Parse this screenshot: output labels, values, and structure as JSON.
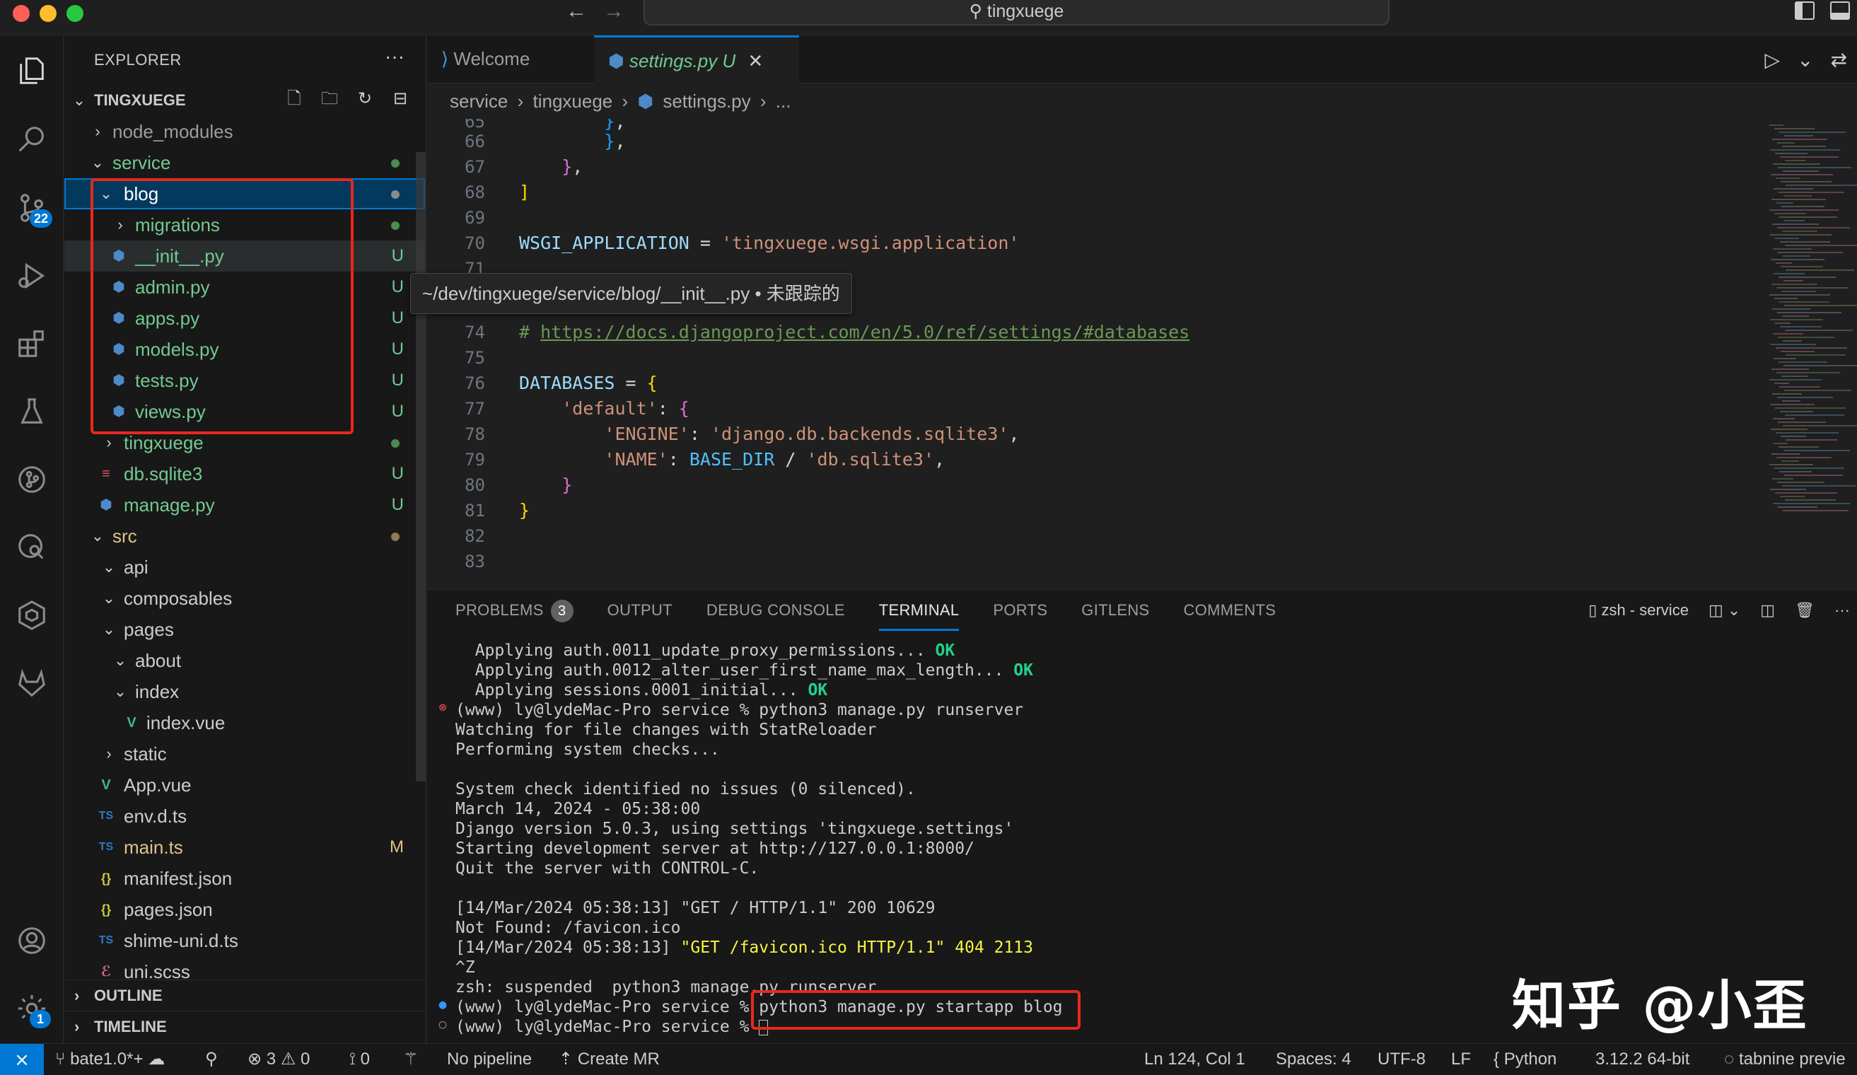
{
  "window": {
    "title": "tingxuege"
  },
  "activity": {
    "scm_badge": "22",
    "settings_badge": "1"
  },
  "sidebar": {
    "title": "EXPLORER",
    "more": "···",
    "root": "TINGXUEGE",
    "tree": [
      {
        "label": "node_modules",
        "status": ""
      },
      {
        "label": "service",
        "status": ""
      },
      {
        "label": "blog",
        "status": ""
      },
      {
        "label": "migrations",
        "status": ""
      },
      {
        "label": "__init__.py",
        "status": "U"
      },
      {
        "label": "admin.py",
        "status": "U"
      },
      {
        "label": "apps.py",
        "status": "U"
      },
      {
        "label": "models.py",
        "status": "U"
      },
      {
        "label": "tests.py",
        "status": "U"
      },
      {
        "label": "views.py",
        "status": "U"
      },
      {
        "label": "tingxuege",
        "status": ""
      },
      {
        "label": "db.sqlite3",
        "status": "U"
      },
      {
        "label": "manage.py",
        "status": "U"
      },
      {
        "label": "src",
        "status": ""
      },
      {
        "label": "api",
        "status": ""
      },
      {
        "label": "composables",
        "status": ""
      },
      {
        "label": "pages",
        "status": ""
      },
      {
        "label": "about",
        "status": ""
      },
      {
        "label": "index",
        "status": ""
      },
      {
        "label": "index.vue",
        "status": ""
      },
      {
        "label": "static",
        "status": ""
      },
      {
        "label": "App.vue",
        "status": ""
      },
      {
        "label": "env.d.ts",
        "status": ""
      },
      {
        "label": "main.ts",
        "status": "M"
      },
      {
        "label": "manifest.json",
        "status": ""
      },
      {
        "label": "pages.json",
        "status": ""
      },
      {
        "label": "shime-uni.d.ts",
        "status": ""
      },
      {
        "label": "uni.scss",
        "status": ""
      }
    ],
    "outline": "OUTLINE",
    "timeline": "TIMELINE"
  },
  "tooltip": "~/dev/tingxuege/service/blog/__init__.py • 未跟踪的",
  "tabs": {
    "welcome": "Welcome",
    "settings": "settings.py",
    "settings_status": "U",
    "close": "✕"
  },
  "breadcrumb": [
    "service",
    "tingxuege",
    "settings.py",
    "..."
  ],
  "editor": {
    "lines": [
      "65",
      "66",
      "67",
      "68",
      "69",
      "70",
      "71",
      "73",
      "74",
      "75",
      "76",
      "77",
      "78",
      "79",
      "80",
      "81",
      "82",
      "83"
    ],
    "wsgi_name": "WSGI_APPLICATION",
    "wsgi_value": "'tingxuege.wsgi.application'",
    "db_comment": "# Database",
    "db_link": "https://docs.djangoproject.com/en/5.0/ref/settings/#databases",
    "databases": "DATABASES",
    "default_key": "'default'",
    "engine_key": "'ENGINE'",
    "engine_val": "'django.db.backends.sqlite3'",
    "name_key": "'NAME'",
    "base_dir": "BASE_DIR",
    "name_val": "'db.sqlite3'"
  },
  "panel": {
    "tabs": [
      "PROBLEMS",
      "OUTPUT",
      "DEBUG CONSOLE",
      "TERMINAL",
      "PORTS",
      "GITLENS",
      "COMMENTS"
    ],
    "problems_count": "3",
    "terminal_name": "zsh - service",
    "lines": [
      {
        "text": "  Applying auth.0011_update_proxy_permissions... ",
        "ok": "OK"
      },
      {
        "text": "  Applying auth.0012_alter_user_first_name_max_length... ",
        "ok": "OK"
      },
      {
        "text": "  Applying sessions.0001_initial... ",
        "ok": "OK"
      },
      {
        "text": "(www) ly@lydeMac-Pro service % python3 manage.py runserver",
        "ok": ""
      },
      {
        "text": "Watching for file changes with StatReloader",
        "ok": ""
      },
      {
        "text": "Performing system checks...",
        "ok": ""
      },
      {
        "text": "",
        "ok": ""
      },
      {
        "text": "System check identified no issues (0 silenced).",
        "ok": ""
      },
      {
        "text": "March 14, 2024 - 05:38:00",
        "ok": ""
      },
      {
        "text": "Django version 5.0.3, using settings 'tingxuege.settings'",
        "ok": ""
      },
      {
        "text": "Starting development server at http://127.0.0.1:8000/",
        "ok": ""
      },
      {
        "text": "Quit the server with CONTROL-C.",
        "ok": ""
      },
      {
        "text": "",
        "ok": ""
      },
      {
        "text": "[14/Mar/2024 05:38:13] \"GET / HTTP/1.1\" 200 10629",
        "ok": ""
      },
      {
        "text": "Not Found: /favicon.ico",
        "ok": ""
      },
      {
        "text": "[14/Mar/2024 05:38:13] ",
        "yellow": "\"GET /favicon.ico HTTP/1.1\" 404 2113"
      },
      {
        "text": "^Z",
        "ok": ""
      },
      {
        "text": "zsh: suspended  python3 manage.py runserver",
        "ok": ""
      },
      {
        "text": "(www) ly@lydeMac-Pro service % python3 manage.py startapp blog",
        "ok": ""
      },
      {
        "text": "(www) ly@lydeMac-Pro service % ",
        "ok": ""
      }
    ]
  },
  "watermark": "知乎 @小歪",
  "status": {
    "branch": "bate1.0*+",
    "errors": "3",
    "warnings": "0",
    "ports": "0",
    "pipeline": "No pipeline",
    "create_mr": "Create MR",
    "position": "Ln 124, Col 1",
    "spaces": "Spaces: 4",
    "encoding": "UTF-8",
    "eol": "LF",
    "language": "Python",
    "interpreter": "3.12.2 64-bit",
    "tabnine": "tabnine previe"
  }
}
